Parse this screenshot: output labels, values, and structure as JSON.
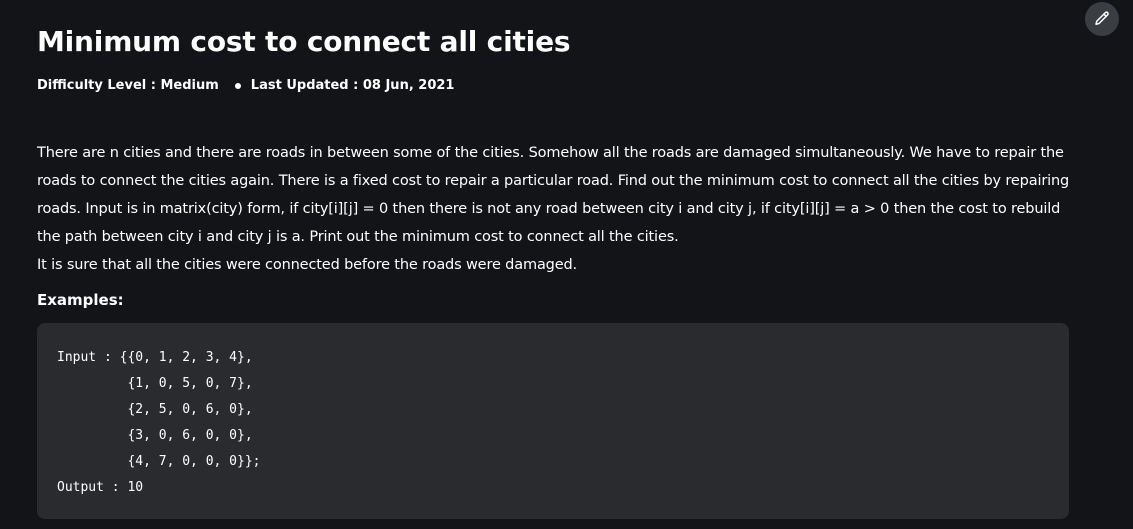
{
  "article": {
    "title": "Minimum cost to connect all cities",
    "meta": {
      "difficulty": "Difficulty Level : Medium",
      "updated": "Last Updated : 08 Jun, 2021"
    },
    "description": [
      "There are n cities and there are roads in between some of the cities. Somehow all the roads are damaged simultaneously. We have to repair the roads to connect the cities again. There is a fixed cost to repair a particular road. Find out the minimum cost to connect all the cities by repairing roads. Input is in matrix(city) form, if city[i][j] = 0 then there is not any road between city i and city j, if city[i][j] = a > 0 then the cost to rebuild the path between city i and city j is a. Print out the minimum cost to connect all the cities.",
      "It is sure that all the cities were connected before the roads were damaged."
    ],
    "examples_heading": "Examples:",
    "code_lines": [
      "Input : {{0, 1, 2, 3, 4},",
      "         {1, 0, 5, 0, 7},",
      "         {2, 5, 0, 6, 0},",
      "         {3, 0, 6, 0, 0},",
      "         {4, 7, 0, 0, 0}};",
      "Output : 10"
    ]
  },
  "toolbar": {
    "edit_icon": "pencil-icon"
  },
  "colors": {
    "background": "#131417",
    "code_background": "#2a2b2e",
    "edit_button": "#3a3d42",
    "text": "#ffffff"
  }
}
